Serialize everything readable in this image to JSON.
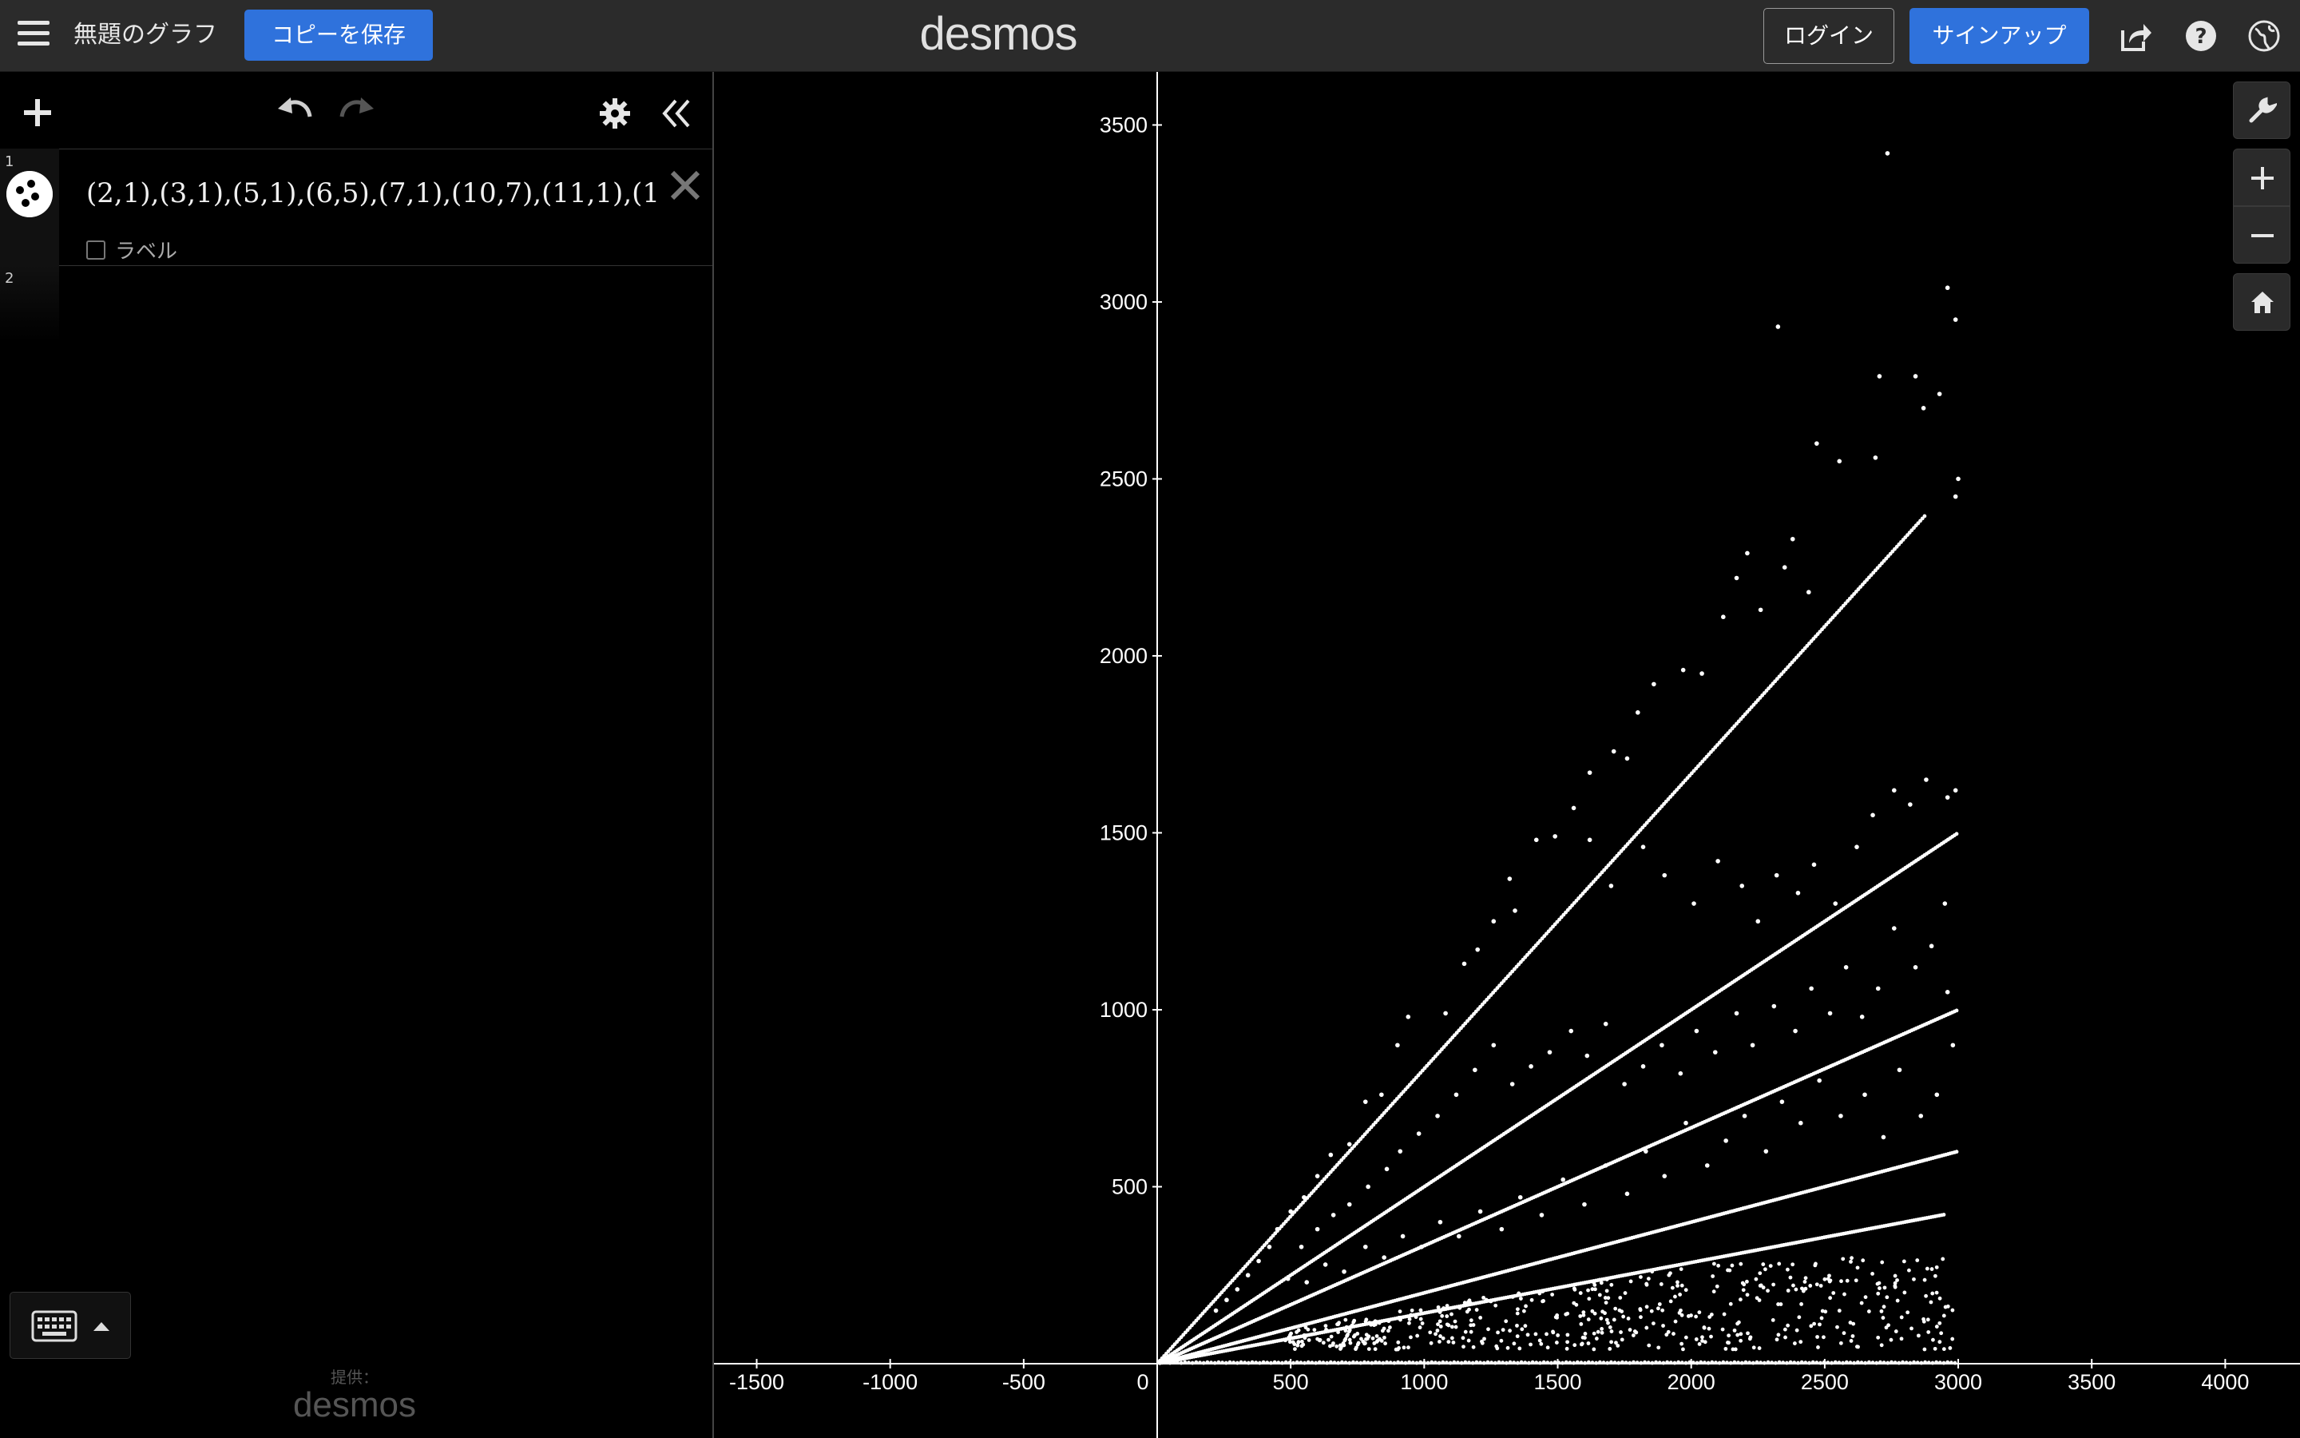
{
  "header": {
    "menu_icon": "hamburger-menu-icon",
    "graph_title": "無題のグラフ",
    "save_copy_label": "コピーを保存",
    "brand": "desmos",
    "login_label": "ログイン",
    "signup_label": "サインアップ",
    "icons": [
      "share-icon",
      "help-icon",
      "globe-icon"
    ]
  },
  "toolbar": {
    "icons": [
      "add-icon",
      "undo-icon",
      "redo-icon",
      "settings-gear-icon",
      "collapse-panel-icon"
    ]
  },
  "expressions": [
    {
      "number": "1",
      "text": "(2,1),(3,1),(5,1),(6,5),(7,1),(10,7),(11,1),(1:",
      "label_checkbox": "ラベル"
    },
    {
      "number": "2",
      "text": ""
    }
  ],
  "footer": {
    "powered_small": "提供：",
    "powered_logo": "desmos",
    "keyboard_icon": "keyboard-icon"
  },
  "graph_tools": {
    "icons": [
      "wrench-icon",
      "zoom-in-icon",
      "zoom-out-icon",
      "home-icon"
    ]
  },
  "colors": {
    "accent_blue": "#2f72dc",
    "header_bg": "#2b2b2b",
    "graph_bg": "#000000",
    "point_color": "#ffffff"
  },
  "chart_data": {
    "type": "scatter",
    "x_ticks": [
      "-1500",
      "-1000",
      "-500",
      "0",
      "500",
      "1000",
      "1500",
      "2000",
      "2500",
      "3000",
      "3500",
      "4000"
    ],
    "y_ticks": [
      "500",
      "1000",
      "1500",
      "2000",
      "2500",
      "3000",
      "3500"
    ],
    "xlim": [
      -1660,
      4280
    ],
    "ylim": [
      -210,
      3650
    ],
    "grid": false,
    "series_lines": [
      {
        "slope": 0.8333,
        "x_max": 2880
      },
      {
        "slope": 0.5,
        "x_max": 3000
      },
      {
        "slope": 0.3333,
        "x_max": 3000
      },
      {
        "slope": 0.2,
        "x_max": 3000
      },
      {
        "slope": 0.1429,
        "x_max": 2950
      }
    ],
    "points": [
      [
        2735,
        3420
      ],
      [
        2960,
        3040
      ],
      [
        2990,
        2950
      ],
      [
        2325,
        2930
      ],
      [
        2705,
        2790
      ],
      [
        2840,
        2790
      ],
      [
        2870,
        2700
      ],
      [
        2930,
        2740
      ],
      [
        3000,
        2500
      ],
      [
        2990,
        2450
      ],
      [
        2470,
        2600
      ],
      [
        2555,
        2550
      ],
      [
        2690,
        2560
      ],
      [
        2380,
        2330
      ],
      [
        2210,
        2290
      ],
      [
        2170,
        2220
      ],
      [
        2260,
        2130
      ],
      [
        2350,
        2250
      ],
      [
        2440,
        2180
      ],
      [
        2120,
        2110
      ],
      [
        1860,
        1920
      ],
      [
        1970,
        1960
      ],
      [
        2040,
        1950
      ],
      [
        1800,
        1840
      ],
      [
        1710,
        1730
      ],
      [
        1760,
        1710
      ],
      [
        1620,
        1670
      ],
      [
        1560,
        1570
      ],
      [
        1490,
        1490
      ],
      [
        1420,
        1480
      ],
      [
        1320,
        1370
      ],
      [
        1340,
        1280
      ],
      [
        1260,
        1250
      ],
      [
        1200,
        1170
      ],
      [
        1150,
        1130
      ],
      [
        1080,
        990
      ],
      [
        940,
        980
      ],
      [
        900,
        900
      ],
      [
        840,
        760
      ],
      [
        780,
        740
      ],
      [
        720,
        620
      ],
      [
        650,
        590
      ],
      [
        600,
        530
      ],
      [
        550,
        470
      ],
      [
        500,
        430
      ],
      [
        450,
        380
      ],
      [
        420,
        330
      ],
      [
        380,
        290
      ],
      [
        340,
        250
      ],
      [
        300,
        210
      ],
      [
        260,
        180
      ],
      [
        220,
        150
      ],
      [
        1620,
        1480
      ],
      [
        1700,
        1350
      ],
      [
        1820,
        1460
      ],
      [
        1900,
        1380
      ],
      [
        2010,
        1300
      ],
      [
        2100,
        1420
      ],
      [
        2190,
        1350
      ],
      [
        2250,
        1250
      ],
      [
        2320,
        1380
      ],
      [
        2400,
        1330
      ],
      [
        2460,
        1410
      ],
      [
        2540,
        1300
      ],
      [
        2620,
        1460
      ],
      [
        2680,
        1550
      ],
      [
        2760,
        1620
      ],
      [
        2820,
        1580
      ],
      [
        2880,
        1650
      ],
      [
        2960,
        1600
      ],
      [
        2990,
        1620
      ],
      [
        2950,
        1300
      ],
      [
        2900,
        1180
      ],
      [
        2840,
        1120
      ],
      [
        2760,
        1230
      ],
      [
        2700,
        1060
      ],
      [
        2640,
        980
      ],
      [
        2580,
        1120
      ],
      [
        2520,
        990
      ],
      [
        2450,
        1060
      ],
      [
        2390,
        940
      ],
      [
        2310,
        1010
      ],
      [
        2230,
        900
      ],
      [
        2170,
        990
      ],
      [
        2090,
        880
      ],
      [
        2020,
        940
      ],
      [
        1960,
        820
      ],
      [
        1890,
        900
      ],
      [
        1820,
        840
      ],
      [
        1750,
        790
      ],
      [
        1680,
        960
      ],
      [
        1610,
        870
      ],
      [
        1550,
        940
      ],
      [
        1470,
        880
      ],
      [
        1400,
        840
      ],
      [
        1330,
        790
      ],
      [
        1260,
        900
      ],
      [
        1190,
        830
      ],
      [
        1120,
        760
      ],
      [
        1050,
        700
      ],
      [
        980,
        650
      ],
      [
        910,
        600
      ],
      [
        860,
        550
      ],
      [
        790,
        500
      ],
      [
        720,
        450
      ],
      [
        660,
        420
      ],
      [
        600,
        380
      ],
      [
        540,
        330
      ],
      [
        2960,
        1050
      ],
      [
        2980,
        900
      ],
      [
        2920,
        760
      ],
      [
        2860,
        700
      ],
      [
        2780,
        830
      ],
      [
        2720,
        640
      ],
      [
        2650,
        760
      ],
      [
        2560,
        700
      ],
      [
        2480,
        800
      ],
      [
        2410,
        680
      ],
      [
        2340,
        740
      ],
      [
        2280,
        600
      ],
      [
        2200,
        700
      ],
      [
        2130,
        630
      ],
      [
        2060,
        560
      ],
      [
        1980,
        680
      ],
      [
        1900,
        530
      ],
      [
        1830,
        600
      ],
      [
        1760,
        480
      ],
      [
        1680,
        560
      ],
      [
        1600,
        450
      ],
      [
        1520,
        520
      ],
      [
        1440,
        420
      ],
      [
        1360,
        470
      ],
      [
        1290,
        380
      ],
      [
        1210,
        430
      ],
      [
        1130,
        360
      ],
      [
        1060,
        400
      ],
      [
        990,
        330
      ],
      [
        920,
        360
      ],
      [
        850,
        300
      ],
      [
        780,
        330
      ],
      [
        700,
        260
      ],
      [
        630,
        280
      ],
      [
        560,
        230
      ],
      [
        490,
        240
      ]
    ],
    "low_band": {
      "x_min": 480,
      "x_max": 3000,
      "y_min": 40,
      "y_max": 300
    }
  }
}
